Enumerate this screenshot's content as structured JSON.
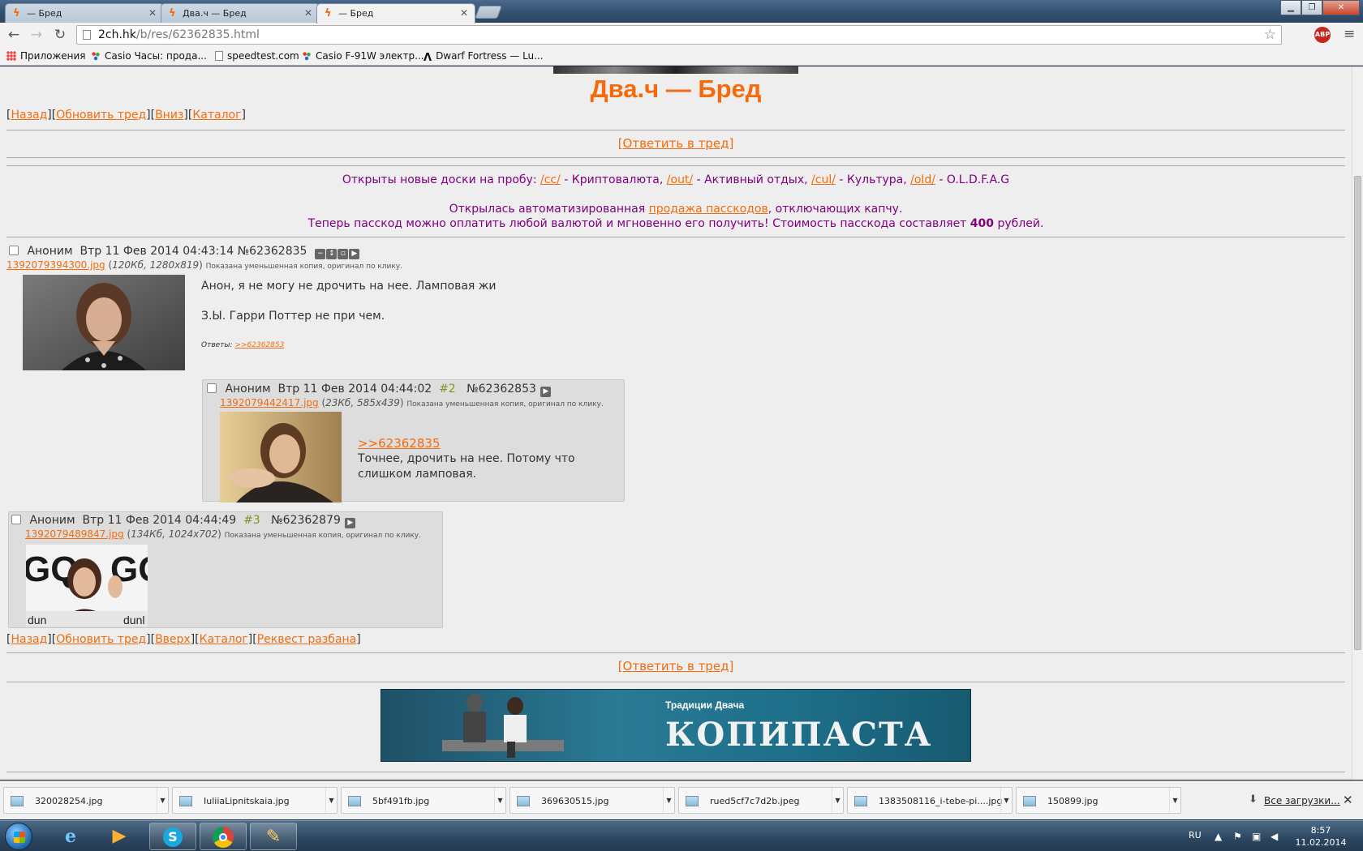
{
  "browser": {
    "tabs": [
      {
        "title": "— Бред",
        "active": false
      },
      {
        "title": "Два.ч — Бред",
        "active": false
      },
      {
        "title": "— Бред",
        "active": true
      }
    ],
    "url_host": "2ch.hk",
    "url_path": "/b/res/62362835.html",
    "bookmarks": [
      {
        "label": "Приложения",
        "icon": "apps-icon"
      },
      {
        "label": "Casio Часы: прода...",
        "icon": "casio-icon"
      },
      {
        "label": "speedtest.com",
        "icon": "doc-icon"
      },
      {
        "label": "Casio F-91W электр...",
        "icon": "casio-icon"
      },
      {
        "label": "Dwarf Fortress — Lu...",
        "icon": "df-icon"
      }
    ],
    "abp_label": "ABP",
    "win_min": "▁",
    "win_max": "❐",
    "win_close": "✕"
  },
  "page": {
    "board_title": "Два.ч — Бред",
    "nav_top": {
      "back": "Назад",
      "refresh": "Обновить тред",
      "down": "Вниз",
      "catalog": "Каталог"
    },
    "reply_in_thread": "[Ответить в тред]",
    "announce": {
      "line1_prefix": "Открыты новые доски на пробу: ",
      "cc": "/cc/",
      "cc_desc": " - Криптовалюта, ",
      "out": "/out/",
      "out_desc": " - Активный отдых, ",
      "cul": "/cul/",
      "cul_desc": " - Культура, ",
      "old": "/old/",
      "old_desc": " - O.L.D.F.A.G",
      "line2_prefix": "Открылась автоматизированная ",
      "line2_link": "продажа пасскодов",
      "line2_suffix": ", отключающих капчу.",
      "line3_prefix": "Теперь пасскод можно оплатить любой валютой и мгновенно его получить! Стоимость пасскода составляет ",
      "line3_price": "400",
      "line3_suffix": " рублей."
    },
    "op": {
      "name": "Аноним",
      "date": "Втр 11 Фев 2014 04:43:14",
      "number": "№62362835",
      "file_name": "1392079394300.jpg",
      "file_meta": "120Кб, 1280x819",
      "file_note": "Показана уменьшенная копия, оригинал по клику.",
      "text1": "Анон, я не могу не дрочить на нее. Ламповая жи",
      "text2": "З.Ы. Гарри Поттер не при чем.",
      "replies_label": "Ответы:",
      "replies_link": ">>62362853"
    },
    "reply2": {
      "name": "Аноним",
      "date": "Втр 11 Фев 2014 04:44:02",
      "ord": "#2",
      "number": "№62362853",
      "file_name": "1392079442417.jpg",
      "file_meta": "23Кб, 585x439",
      "file_note": "Показана уменьшенная копия, оригинал по клику.",
      "quote": ">>62362835",
      "text1": "Точнее, дрочить на нее. Потому что",
      "text2": "слишком ламповая."
    },
    "reply3": {
      "name": "Аноним",
      "date": "Втр 11 Фев 2014 04:44:49",
      "ord": "#3",
      "number": "№62362879",
      "file_name": "1392079489847.jpg",
      "file_meta": "134Кб, 1024x702",
      "file_note": "Показана уменьшенная копия, оригинал по клику."
    },
    "nav_bottom": {
      "back": "Назад",
      "refresh": "Обновить тред",
      "up": "Вверх",
      "catalog": "Каталог",
      "request": "Реквест разбана"
    },
    "ad": {
      "subtitle": "Традиции Двача",
      "title": "КОПИПАСТА"
    }
  },
  "downloads": {
    "items": [
      "320028254.jpg",
      "IuliiaLipnitskaia.jpg",
      "5bf491fb.jpg",
      "369630515.jpg",
      "rued5cf7c7d2b.jpeg",
      "1383508116_i-tebe-pi....jpg",
      "150899.jpg"
    ],
    "all_label": "Все загрузки...",
    "close": "✕"
  },
  "taskbar": {
    "lang": "RU",
    "time": "8:57",
    "date": "11.02.2014"
  }
}
